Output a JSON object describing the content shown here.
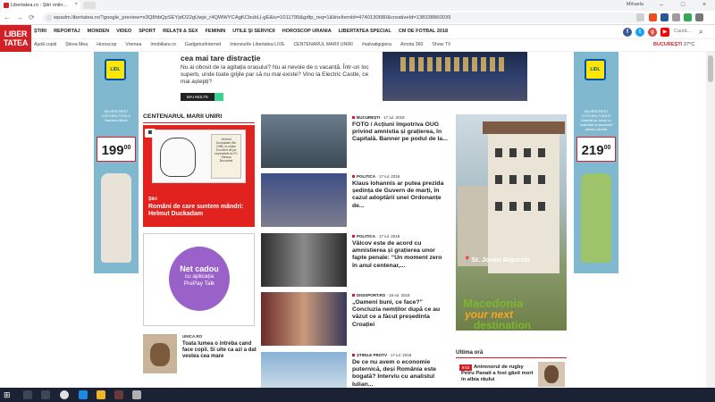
{
  "browser": {
    "tab_title": "Libertatea.ro - Știri onlin...",
    "url": "wpadm.libertatea.ro/?google_preview=x3Q8hbQpSEYjdO22gUwje_r4QWWYCAgKCbubL|-gE&iu=1011795&gdfp_req=1&lineItemId=4740130680&creativeId=138338860039",
    "user": "Mihaela",
    "window_controls": [
      "–",
      "□",
      "×"
    ]
  },
  "site": {
    "logo_line1": "LIBER",
    "logo_line2": "TATEA",
    "main_nav": [
      "ȘTIRI",
      "REPORTAJ",
      "MONDEN",
      "VIDEO",
      "SPORT",
      "RELAȚII & SEX",
      "FEMININ",
      "UTILE ȘI SERVICII",
      "HOROSCOP URANIA",
      "LIBERTATEA SPECIAL",
      "CM DE FOTBAL 2018"
    ],
    "sub_nav": [
      "Ajută copiii",
      "Știrea Mea",
      "Horoscop",
      "Vremea",
      "Imobiliare.ro",
      "GadgeturiInternet",
      "Interviurile Libertatea LIVE",
      "CENTENARUL MARII UNIRI",
      "#salvatigigiera",
      "Arnota 360",
      "Show TV"
    ],
    "search_placeholder": "Caută...",
    "city": "BUCUREȘTI",
    "temperature": "27°C",
    "social": [
      "f",
      "t",
      "g",
      "▶"
    ]
  },
  "side_ads": {
    "left": {
      "brand": "LIDL",
      "desc": "SILVERCREST KITCHEN TOOLS Nutrition Mixer",
      "price_main": "199",
      "price_sup": "00"
    },
    "right": {
      "brand": "LIDL",
      "desc": "SILVERCREST KITCHEN TOOLS Mașină de tocat cu ustensile și accesorii pentru cârnați",
      "price_main": "219",
      "price_sup": "00"
    }
  },
  "top_ad": {
    "title": "cea mai tare distracție",
    "text": "Nu ai obosit de la agitația orașului? Nu ai nevoie de o vacanță. Într-un loc superb, unde toate grijile par să nu mai existe? Vino la Electric Castle, ce mai aștepți?",
    "button": "MAI MULTE"
  },
  "section": {
    "title": "CENTENARUL MARII UNIRI",
    "feature": {
      "category": "Știri",
      "title": "Români de care suntem mândri: Helmut Duckadam",
      "book_text": "Helmut Duckadam Bin 1986, la mijloc Eurofied de pe seperatele la FC Steaua Bucuresti"
    }
  },
  "promo": {
    "line1": "Net cadou",
    "line2": "cu aplicația",
    "line3": "PrePay Talk"
  },
  "small_article": {
    "category": "UNICA.RO",
    "title": "Toata lumea o intreba cand face copii. Si uite ca azi a dat vestea cea mare"
  },
  "news": [
    {
      "category": "BUCUREȘTI",
      "date": "17 iul. 2018",
      "title": "FOTO / Acțiuni împotriva OUG privind amnistia și grațierea, în Capitală. Banner pe podul de la..."
    },
    {
      "category": "POLITICA",
      "date": "17 iul. 2018",
      "title": "Klaus Iohannis ar putea prezida ședința de Guvern de marți, în cazul adoptării unei Ordonanțe de..."
    },
    {
      "category": "POLITICA",
      "date": "17 iul. 2018",
      "title": "Vâlcov este de acord cu amnistierea și grațierea unor fapte penale: “Un moment zero în anul centenar,..."
    },
    {
      "category": "DIGISPORT.RO",
      "date": "16 iul. 2018",
      "title": "„Oameni buni, ce face?” Concluzia nemților după ce au văzut ce a făcut președinta Croației"
    },
    {
      "category": "ȘTIRILE PROTV",
      "date": "17 iul. 2018",
      "title": "De ce nu avem o economie puternică, deși România este bogată? Interviu cu analistul Iulian..."
    }
  ],
  "big_ad": {
    "place": "St. Jovan Bigorski",
    "line1": "Macedonia",
    "line2": "your next",
    "line3": "destination"
  },
  "ultima": {
    "header": "Ultima oră",
    "badge": "9:53",
    "text": "Antrenorul de rugby Petru Panait a fost găsit mort în albia râului"
  },
  "colors": {
    "brand": "#d32027",
    "promo": "#9a61c9",
    "taskbar": "#1b2233"
  }
}
